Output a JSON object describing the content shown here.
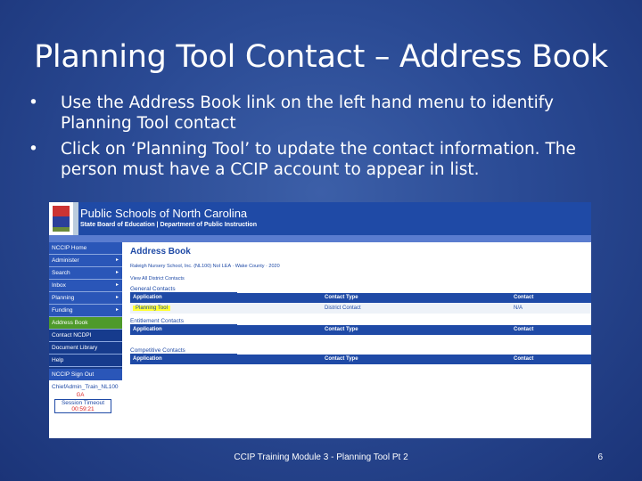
{
  "slide": {
    "title": "Planning Tool Contact – Address Book",
    "bullets": [
      "Use the Address Book link on the left hand menu to identify Planning Tool contact",
      "Click on ‘Planning Tool’ to update the contact information. The person must have a CCIP account to appear in list."
    ],
    "footer": "CCIP Training Module 3 - Planning Tool Pt 2",
    "page_number": "6"
  },
  "app": {
    "org_name": "Public Schools of North Carolina",
    "org_sub": "State Board of Education | Department of Public Instruction",
    "menu": [
      {
        "label": "NCCIP Home",
        "arrow": ""
      },
      {
        "label": "Administer",
        "arrow": "▸"
      },
      {
        "label": "Search",
        "arrow": "▸"
      },
      {
        "label": "Inbox",
        "arrow": "▸"
      },
      {
        "label": "Planning",
        "arrow": "▸"
      },
      {
        "label": "Funding",
        "arrow": "▸"
      },
      {
        "label": "Address Book",
        "arrow": ""
      },
      {
        "label": "Contact NCDPI",
        "arrow": ""
      },
      {
        "label": "Document Library",
        "arrow": ""
      },
      {
        "label": "Help",
        "arrow": ""
      }
    ],
    "signout": "NCCIP Sign Out",
    "user": "ChiefAdmin_Train_NL100",
    "ga": "GA",
    "session_label": "Session Timeout",
    "session_time": "00:59:21",
    "page_title": "Address Book",
    "org_line": "Raleigh Nursery School, Inc. (NL100) NoI LEA · Wake County · 2020",
    "view_all": "View All District Contacts",
    "sections": [
      {
        "title": "General Contacts",
        "headers": [
          "Application",
          "Contact Type",
          "Contact"
        ],
        "rows": [
          [
            "Planning Tool",
            "District Contact",
            "N/A"
          ]
        ]
      },
      {
        "title": "Entitlement Contacts",
        "headers": [
          "Application",
          "Contact Type",
          "Contact"
        ],
        "rows": []
      },
      {
        "title": "Competitive Contacts",
        "headers": [
          "Application",
          "Contact Type",
          "Contact"
        ],
        "rows": []
      }
    ]
  }
}
